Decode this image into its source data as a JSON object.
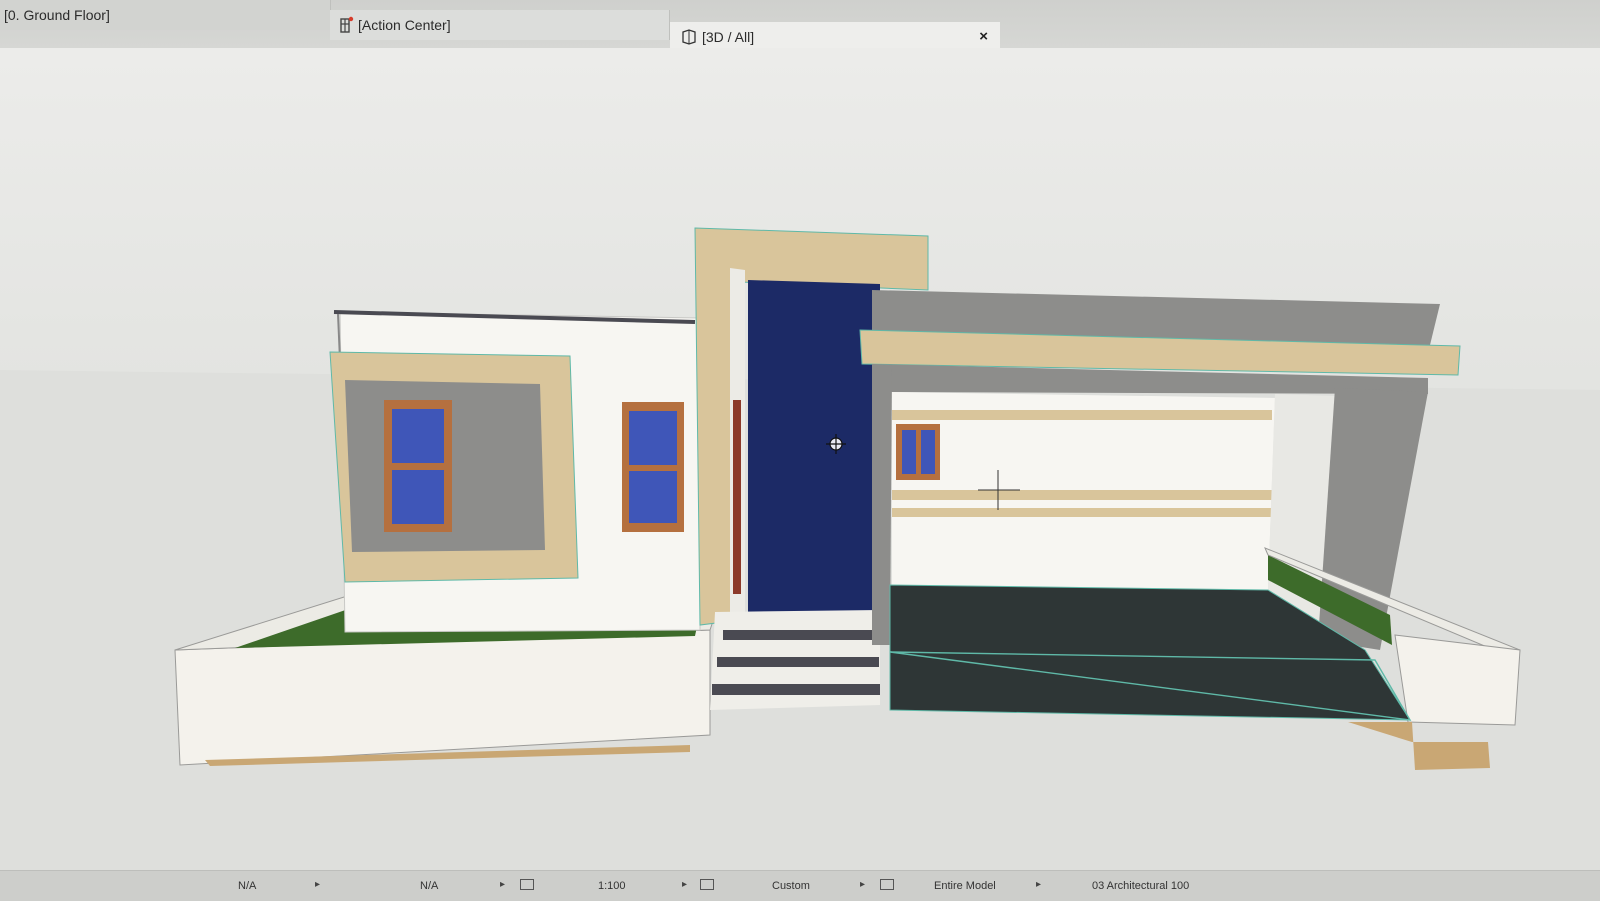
{
  "tabs": {
    "ground_floor": "[0. Ground Floor]",
    "action_center": "[Action Center]",
    "view_3d": "[3D / All]",
    "close_glyph": "×"
  },
  "statusbar": {
    "field1": "N/A",
    "field2": "N/A",
    "scale": "1:100",
    "custom": "Custom",
    "entire_model": "Entire Model",
    "layer_combo": "03 Architectural 100"
  },
  "colors": {
    "door_blue": "#1c2a66",
    "trim_tan": "#d9c59b",
    "concrete_grey": "#8d8d8b",
    "floor_dark": "#2e3636",
    "lawn_green": "#3d6b2a",
    "window_frame": "#b5703f",
    "glass_blue": "#3f56b8"
  },
  "icons": [
    "action-center-icon",
    "3d-view-icon",
    "close-icon",
    "orbit-cursor-icon",
    "crosshair-icon"
  ]
}
